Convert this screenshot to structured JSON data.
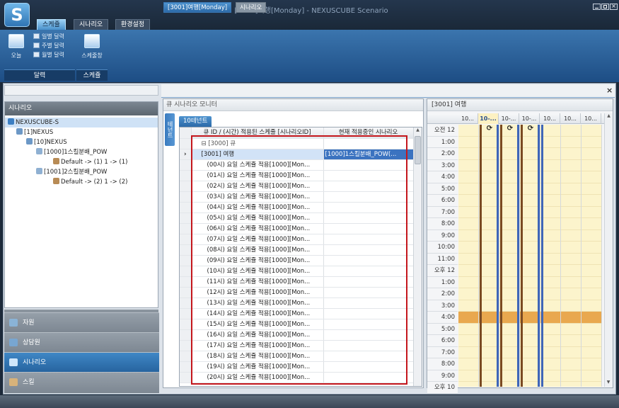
{
  "app": {
    "logo_letter": "S",
    "title": "[3001]여행[Monday] - NEXUSCUBE Scenario",
    "ribbon_tabs": [
      {
        "label": "스케쥴",
        "active": true
      },
      {
        "label": "시나리오",
        "active": false
      },
      {
        "label": "환경설정",
        "active": false
      }
    ]
  },
  "ribbon": {
    "today_label": "오늘",
    "calendar_items": [
      "일별 달력",
      "주별 달력",
      "월별 달력"
    ],
    "schedule_window_label": "스케줄창",
    "group_calendar": "달력",
    "group_schedule": "스케쥴"
  },
  "left": {
    "header": "시나리오",
    "tree": [
      {
        "label": "NEXUSCUBE-S",
        "level": 0,
        "selected": true
      },
      {
        "label": "[1]NEXUS",
        "level": 1
      },
      {
        "label": "[10]NEXUS",
        "level": 2
      },
      {
        "label": "[1000]1스킬분배_POW",
        "level": 3
      },
      {
        "label": "Default -> (1)  1 -> (1)",
        "level": 4
      },
      {
        "label": "[1001]2스킬분배_POW",
        "level": 3
      },
      {
        "label": "Default -> (2)  1 -> (2)",
        "level": 4
      }
    ],
    "nav": [
      {
        "label": "자원",
        "active": false
      },
      {
        "label": "상담원",
        "active": false
      },
      {
        "label": "시나리오",
        "active": true
      },
      {
        "label": "스킬",
        "active": false
      }
    ]
  },
  "doc_tabs": [
    {
      "label": "[3001]여행[Monday]",
      "active": true
    },
    {
      "label": "시나리오",
      "active": false
    }
  ],
  "close_glyph": "×",
  "monitor": {
    "header": "큐 시나리오 모니터",
    "side_tab": "테넌트",
    "tenant_tab": "10테넌트",
    "col1": "큐 ID / (시간) 적용된 스케줄 [시나리오ID]",
    "col2": "현재 적용중인 시나리오",
    "group_row": "[3000] 큐",
    "selected_row": {
      "col1": "[3001] 여행",
      "col2": "[1000]1스킬분배_POW(..."
    },
    "rows": [
      "(00시) 요일 스케쥴 적용[1000][Mon...",
      "(01시) 요일 스케쥴 적용[1000][Mon...",
      "(02시) 요일 스케쥴 적용[1000][Mon...",
      "(03시) 요일 스케쥴 적용[1000][Mon...",
      "(04시) 요일 스케쥴 적용[1000][Mon...",
      "(05시) 요일 스케쥴 적용[1000][Mon...",
      "(06시) 요일 스케쥴 적용[1000][Mon...",
      "(07시) 요일 스케쥴 적용[1000][Mon...",
      "(08시) 요일 스케쥴 적용[1000][Mon...",
      "(09시) 요일 스케쥴 적용[1000][Mon...",
      "(10시) 요일 스케쥴 적용[1000][Mon...",
      "(11시) 요일 스케쥴 적용[1000][Mon...",
      "(12시) 요일 스케쥴 적용[1000][Mon...",
      "(13시) 요일 스케쥴 적용[1000][Mon...",
      "(14시) 요일 스케쥴 적용[1000][Mon...",
      "(15시) 요일 스케쥴 적용[1000][Mon...",
      "(16시) 요일 스케쥴 적용[1000][Mon...",
      "(17시) 요일 스케쥴 적용[1000][Mon...",
      "(18시) 요일 스케쥴 적용[1000][Mon...",
      "(19시) 요일 스케쥴 적용[1000][Mon...",
      "(20시) 요일 스케쥴 적용[1000][Mon..."
    ]
  },
  "calendar": {
    "header": "[3001] 여행",
    "day_headers": [
      "10...",
      "10-...",
      "10-...",
      "10-...",
      "10...",
      "10...",
      "10..."
    ],
    "refresh_glyph": "⟳",
    "times": [
      "오전 12",
      "1:00",
      "2:00",
      "3:00",
      "4:00",
      "5:00",
      "6:00",
      "7:00",
      "8:00",
      "9:00",
      "10:00",
      "11:00",
      "오후 12",
      "1:00",
      "2:00",
      "3:00",
      "4:00",
      "5:00",
      "6:00",
      "7:00",
      "8:00",
      "9:00",
      "오후 10"
    ],
    "colors": {
      "slot": "#fcf4cc",
      "highlight": "#e9a84f",
      "bar_brown": "#7a4a22",
      "bar_blue": "#3f66b8"
    }
  }
}
